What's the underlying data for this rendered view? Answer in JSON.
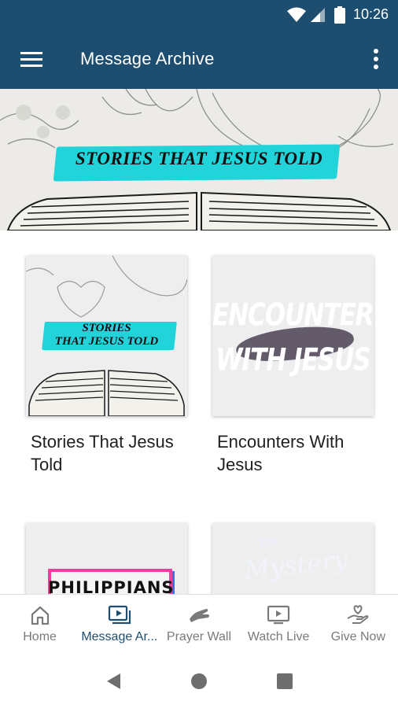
{
  "status_bar": {
    "time": "10:26"
  },
  "app_bar": {
    "title": "Message Archive"
  },
  "hero": {
    "title": "STORIES THAT JESUS TOLD"
  },
  "series": [
    {
      "name": "Stories That Jesus Told",
      "thumb_line1": "STORIES",
      "thumb_line2": "THAT JESUS TOLD"
    },
    {
      "name": "Encounters With Jesus",
      "thumb_line1": "ENCOUNTERS",
      "thumb_line2": "WITH JESUS"
    },
    {
      "name": "",
      "thumb_text": "PHILIPPIANS"
    },
    {
      "name": "",
      "thumb_line1": "The",
      "thumb_line2": "Mystery"
    }
  ],
  "bottom_nav": [
    {
      "label": "Home",
      "icon": "home-icon",
      "active": false
    },
    {
      "label": "Message Ar...",
      "icon": "video-library-icon",
      "active": true
    },
    {
      "label": "Prayer Wall",
      "icon": "praying-hands-icon",
      "active": false
    },
    {
      "label": "Watch Live",
      "icon": "live-tv-icon",
      "active": false
    },
    {
      "label": "Give Now",
      "icon": "hand-heart-icon",
      "active": false
    }
  ],
  "colors": {
    "primary": "#1d4e6f",
    "accent_cyan": "#22d3d9",
    "inactive": "#7a7a7a"
  }
}
